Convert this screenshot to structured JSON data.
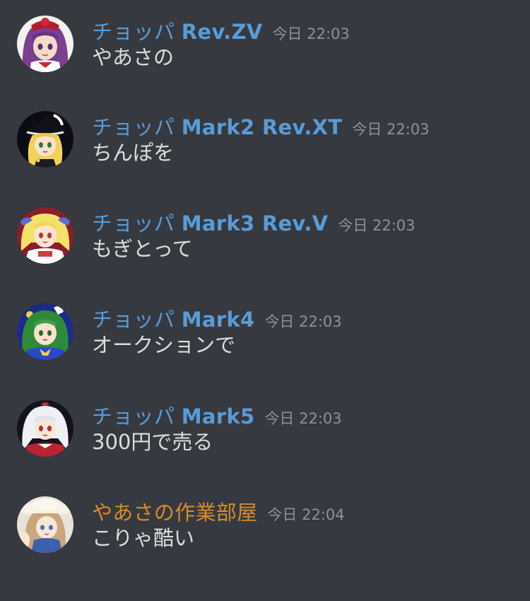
{
  "colors": {
    "background": "#36393f",
    "bot_name": "#5b9bd5",
    "user_name": "#d68b28",
    "timestamp": "#8e9297",
    "text": "#dcddde"
  },
  "messages": [
    {
      "name_prefix": "チョッパ",
      "name_handle": "Rev.ZV",
      "name_color": "#5b9bd5",
      "timestamp": "今日 22:03",
      "text": "やあさの",
      "avatar_icon": "purple-hair-anime-avatar-icon"
    },
    {
      "name_prefix": "チョッパ",
      "name_handle": "Mark2 Rev.XT",
      "name_color": "#5b9bd5",
      "timestamp": "今日 22:03",
      "text": "ちんぽを",
      "avatar_icon": "witch-hat-anime-avatar-icon"
    },
    {
      "name_prefix": "チョッパ",
      "name_handle": "Mark3 Rev.V",
      "name_color": "#5b9bd5",
      "timestamp": "今日 22:03",
      "text": "もぎとって",
      "avatar_icon": "blonde-hair-anime-avatar-icon"
    },
    {
      "name_prefix": "チョッパ",
      "name_handle": "Mark4",
      "name_color": "#5b9bd5",
      "timestamp": "今日 22:03",
      "text": "オークションで",
      "avatar_icon": "green-hair-anime-avatar-icon"
    },
    {
      "name_prefix": "チョッパ",
      "name_handle": "Mark5",
      "name_color": "#5b9bd5",
      "timestamp": "今日 22:03",
      "text": "300円で売る",
      "avatar_icon": "white-hair-anime-avatar-icon"
    },
    {
      "name_prefix": "やあさの作業部屋",
      "name_handle": "",
      "name_color": "#d68b28",
      "timestamp": "今日 22:04",
      "text": "こりゃ酷い",
      "avatar_icon": "straw-hat-anime-avatar-icon"
    }
  ]
}
